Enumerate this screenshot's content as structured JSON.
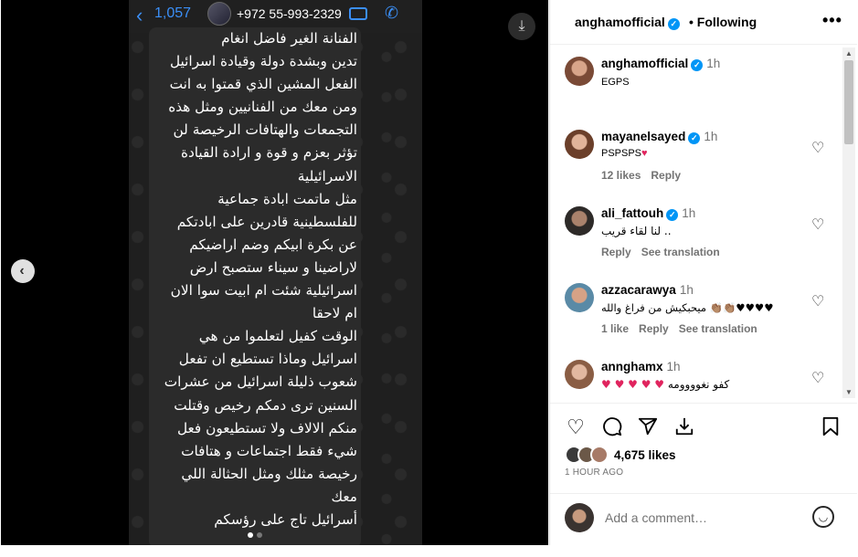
{
  "chat": {
    "back_count": "1,057",
    "phone": "+972 55-993-2329",
    "lines": [
      "الفنانة الغير فاضل انغام",
      "تدين وبشدة دولة وقيادة اسرائيل",
      "الفعل المشين الذي قمتوا به انت",
      "ومن معك من الفنانيين ومثل هذه",
      "التجمعات والهتافات الرخيصة لن",
      "تؤثر بعزم و قوة و ارادة القيادة",
      "الاسرائيلية",
      "مثل ماتمت ابادة جماعية",
      "للفلسطينية قادرين على ابادتكم",
      "عن بكرة ابيكم وضم اراضيكم",
      "لاراضينا و سيناء ستصبح ارض",
      "اسرائيلية شئت ام ابيت سوا الان",
      "ام لاحقا",
      "الوقت كفيل لتعلموا من هي",
      "اسرائيل وماذا تستطيع ان تفعل",
      "شعوب ذليلة اسرائيل من عشرات",
      "السنين ترى دمكم رخيص وقتلت",
      "منكم الالاف ولا تستطيعون فعل",
      "شيء فقط اجتماعات و هتافات",
      "رخيصة مثلك ومثل الحثالة اللي",
      "معك",
      "أسرائيل تاج على رؤسكم"
    ]
  },
  "post": {
    "username": "anghamofficial",
    "follow_status": "Following",
    "caption_user": "anghamofficial",
    "caption_time": "1h",
    "caption_text": "EGPS",
    "likes": "4,675 likes",
    "posted_ago": "1 HOUR AGO",
    "add_comment_placeholder": "Add a comment…"
  },
  "comments": [
    {
      "user": "mayanelsayed",
      "time": "1h",
      "text": "PSPSPS",
      "likes": "12 likes",
      "reply": "Reply",
      "translate": "",
      "rtl": false,
      "hearts": "red-heart",
      "verified": true
    },
    {
      "user": "ali_fattouh",
      "time": "1h",
      "text": "لنا لقاء قريب ..",
      "likes": "",
      "reply": "Reply",
      "translate": "See translation",
      "rtl": true,
      "hearts": "",
      "verified": true
    },
    {
      "user": "azzacarawya",
      "time": "1h",
      "text": "ميحبكيش من فراغ والله 👏🏽👏🏽♥♥♥♥",
      "likes": "1 like",
      "reply": "Reply",
      "translate": "See translation",
      "rtl": true,
      "hearts": "",
      "verified": false
    },
    {
      "user": "annghamx",
      "time": "1h",
      "text": "كفو نغوووومه",
      "likes": "",
      "reply": "",
      "translate": "",
      "rtl": true,
      "hearts": "red-heart",
      "verified": false
    }
  ],
  "colors": {
    "accent_blue": "#0095f6",
    "whatsapp_blue": "#3b8ff7",
    "heart_red": "#e0245e"
  },
  "icons": {
    "like": "heart-icon",
    "comment": "comment-icon",
    "share": "paper-plane-icon",
    "save": "bookmark-icon",
    "emoji": "smiley-icon",
    "download": "download-icon",
    "prev": "chevron-left-icon"
  }
}
